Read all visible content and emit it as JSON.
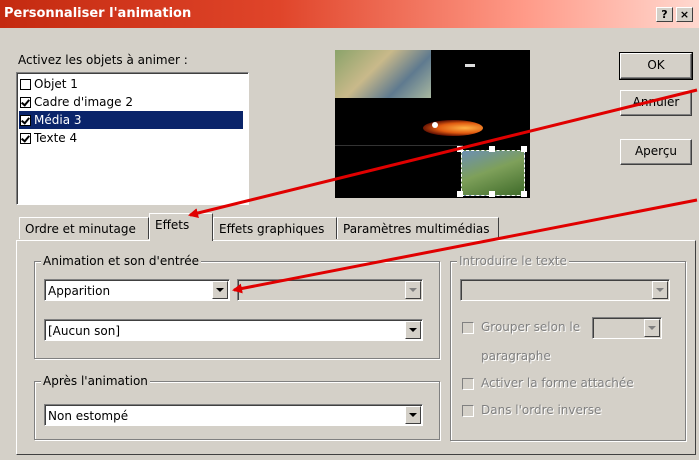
{
  "window": {
    "title": "Personnaliser l'animation",
    "help_label": "?",
    "close_label": "×"
  },
  "objects_label": "Activez les objets à animer :",
  "objects": [
    {
      "label": "Objet 1",
      "checked": false,
      "selected": false
    },
    {
      "label": "Cadre d'image 2",
      "checked": true,
      "selected": false
    },
    {
      "label": "Média 3",
      "checked": true,
      "selected": true
    },
    {
      "label": "Texte 4",
      "checked": true,
      "selected": false
    }
  ],
  "buttons": {
    "ok": "OK",
    "cancel": "Annuler",
    "preview": "Aperçu"
  },
  "tabs": [
    "Ordre et minutage",
    "Effets",
    "Effets graphiques",
    "Paramètres multimédias"
  ],
  "active_tab": "Effets",
  "entry_group": {
    "title": "Animation et son d'entrée",
    "effect_value": "Apparition",
    "sound_value": "[Aucun son]"
  },
  "after_group": {
    "title": "Après l'animation",
    "value": "Non estompé"
  },
  "text_group": {
    "title": "Introduire le texte",
    "group_by_label": "Grouper selon le",
    "paragraph_label": "paragraphe",
    "attached_shape_label": "Activer la forme attachée",
    "reverse_order_label": "Dans l'ordre inverse"
  },
  "colors": {
    "title_start": "#c42a10",
    "title_end": "#ffd8cf",
    "selection": "#0a246a",
    "annotation_arrow": "#e00000"
  },
  "icons": [
    "help-icon",
    "close-icon",
    "checkbox-icon",
    "dropdown-arrow-icon",
    "annotation-arrow-icon"
  ]
}
